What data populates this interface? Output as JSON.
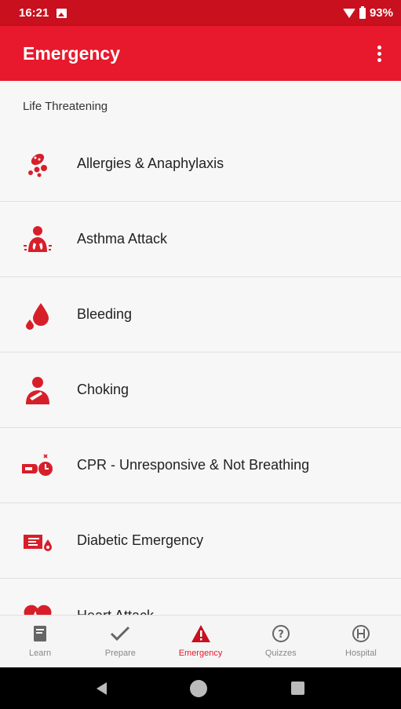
{
  "status_bar": {
    "time": "16:21",
    "battery": "93%"
  },
  "app_bar": {
    "title": "Emergency"
  },
  "section": {
    "title": "Life Threatening"
  },
  "items": [
    {
      "label": "Allergies & Anaphylaxis",
      "icon": "allergy-icon"
    },
    {
      "label": "Asthma Attack",
      "icon": "asthma-icon"
    },
    {
      "label": "Bleeding",
      "icon": "bleeding-icon"
    },
    {
      "label": "Choking",
      "icon": "choking-icon"
    },
    {
      "label": "CPR - Unresponsive & Not Breathing",
      "icon": "cpr-icon"
    },
    {
      "label": "Diabetic Emergency",
      "icon": "diabetic-icon"
    },
    {
      "label": "Heart Attack",
      "icon": "heart-attack-icon"
    }
  ],
  "bottom_nav": [
    {
      "label": "Learn",
      "icon": "book-icon"
    },
    {
      "label": "Prepare",
      "icon": "checkmark-icon"
    },
    {
      "label": "Emergency",
      "icon": "warning-icon",
      "active": true
    },
    {
      "label": "Quizzes",
      "icon": "question-icon"
    },
    {
      "label": "Hospital",
      "icon": "hospital-icon"
    }
  ],
  "colors": {
    "primary": "#e8192c",
    "status": "#c8101e",
    "inactive": "#888888"
  }
}
